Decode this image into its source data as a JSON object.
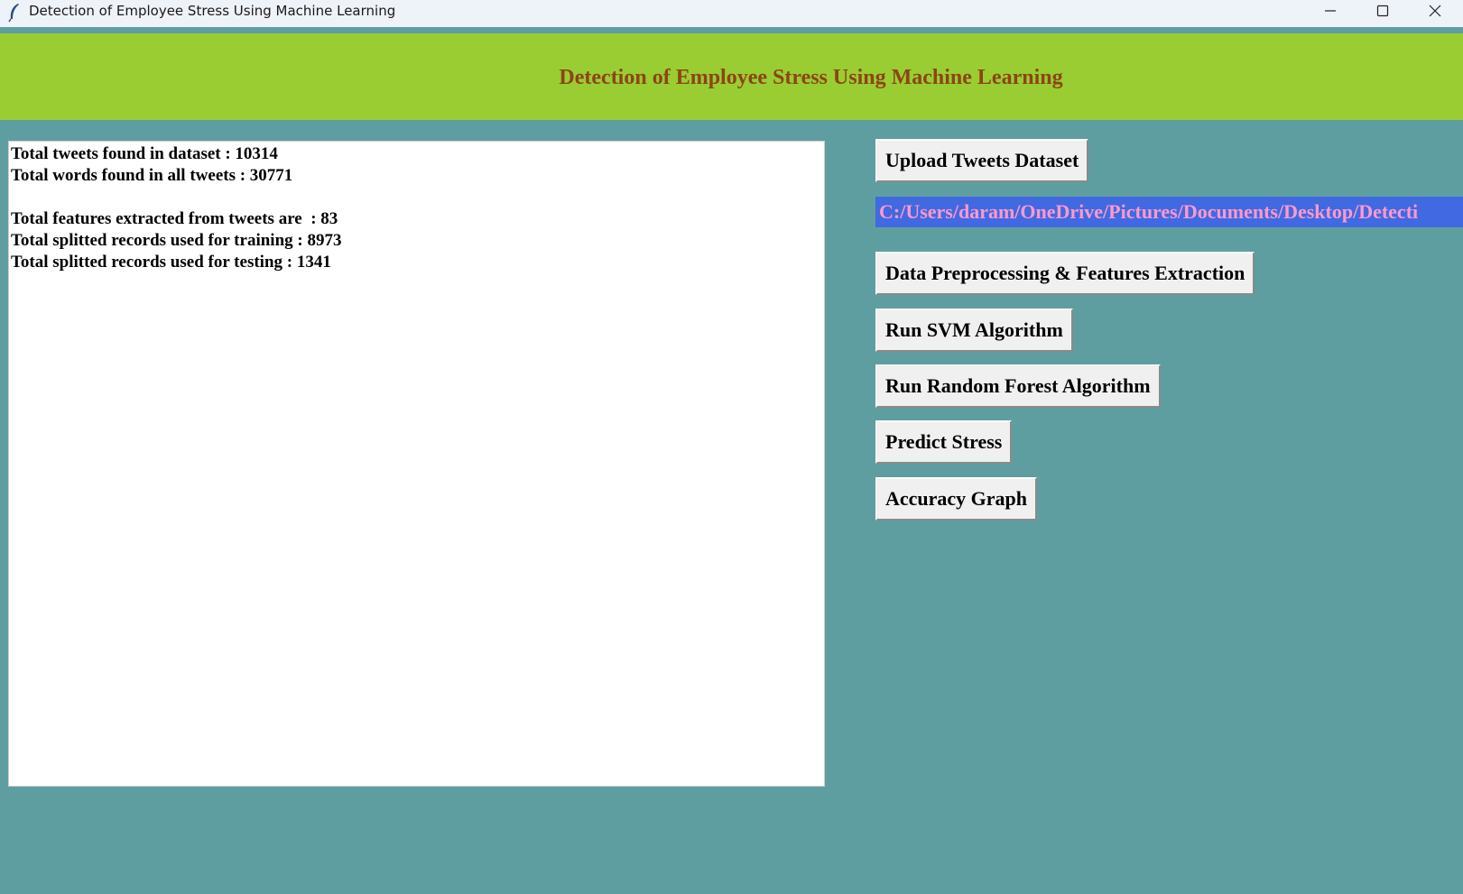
{
  "window": {
    "title": "Detection of Employee Stress Using Machine Learning",
    "icon": "feather-icon",
    "controls": [
      "minimize-icon",
      "maximize-icon",
      "close-icon"
    ]
  },
  "header": {
    "title": "Detection of Employee Stress Using Machine Learning"
  },
  "output": {
    "lines": [
      "Total tweets found in dataset : 10314",
      "Total words found in all tweets : 30771",
      "",
      "Total features extracted from tweets are  : 83",
      "Total splitted records used for training : 8973",
      "Total splitted records used for testing : 1341"
    ]
  },
  "controls": {
    "upload_label": "Upload Tweets Dataset",
    "path": "C:/Users/daram/OneDrive/Pictures/Documents/Desktop/Detecti",
    "preprocess_label": "Data Preprocessing & Features Extraction",
    "svm_label": "Run SVM Algorithm",
    "rf_label": "Run Random Forest Algorithm",
    "predict_label": "Predict Stress",
    "graph_label": "Accuracy Graph"
  },
  "colors": {
    "background": "#5f9ea0",
    "header_band": "#9acd32",
    "header_text": "#8b4513",
    "path_background": "#4169e1",
    "path_text": "#ff99cc",
    "button_face": "#f0f0f0"
  }
}
